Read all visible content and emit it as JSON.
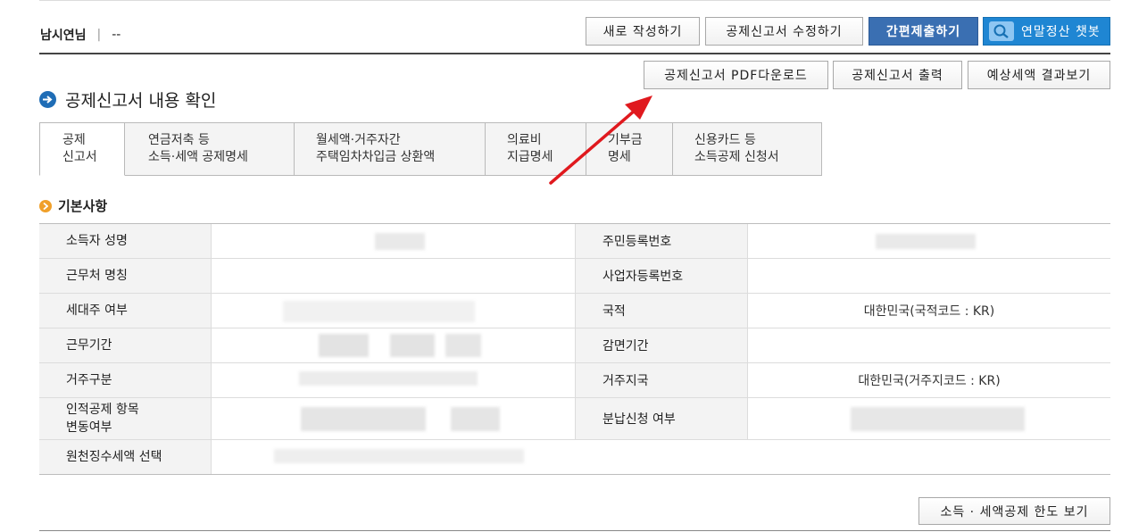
{
  "user": {
    "name": "남시연님",
    "separator": "|",
    "extra": "--"
  },
  "toolbar": {
    "new_label": "새로 작성하기",
    "edit_label": "공제신고서 수정하기",
    "submit_label": "간편제출하기",
    "chatbot_label": "연말정산 챗봇",
    "chatbot_icon": "search-globe-icon"
  },
  "actions": {
    "pdf_label": "공제신고서 PDF다운로드",
    "print_label": "공제신고서 출력",
    "estimate_label": "예상세액 결과보기"
  },
  "section": {
    "title": "공제신고서 내용 확인"
  },
  "tabs": [
    {
      "label": "공제\n신고서"
    },
    {
      "label": "연금저축 등\n소득·세액 공제명세"
    },
    {
      "label": "월세액·거주자간\n주택임차차입금 상환액"
    },
    {
      "label": "의료비\n지급명세"
    },
    {
      "label": "기부금\n명세"
    },
    {
      "label": "신용카드 등\n소득공제 신청서"
    }
  ],
  "basic": {
    "title": "기본사항",
    "rows": [
      {
        "label": "소득자 성명",
        "value": "",
        "label2": "주민등록번호",
        "value2": ""
      },
      {
        "label": "근무처 명칭",
        "value": "",
        "label2": "사업자등록번호",
        "value2": ""
      },
      {
        "label": "세대주 여부",
        "value": "",
        "label2": "국적",
        "value2": "대한민국(국적코드 : KR)"
      },
      {
        "label": "근무기간",
        "value": "",
        "label2": "감면기간",
        "value2": ""
      },
      {
        "label": "거주구분",
        "value": "",
        "label2": "거주지국",
        "value2": "대한민국(거주지코드 : KR)"
      },
      {
        "label": "인적공제 항목\n변동여부",
        "value": "",
        "label2": "분납신청 여부",
        "value2": ""
      },
      {
        "label": "원천징수세액 선택",
        "value": "",
        "label2": "",
        "value2": ""
      }
    ]
  },
  "footer": {
    "limit_label": "소득 · 세액공제 한도 보기"
  },
  "colors": {
    "primary": "#3a6fb2",
    "chatbot": "#1f86d3",
    "arrow": "#e0191e",
    "bullet_orange": "#f0a02a"
  }
}
